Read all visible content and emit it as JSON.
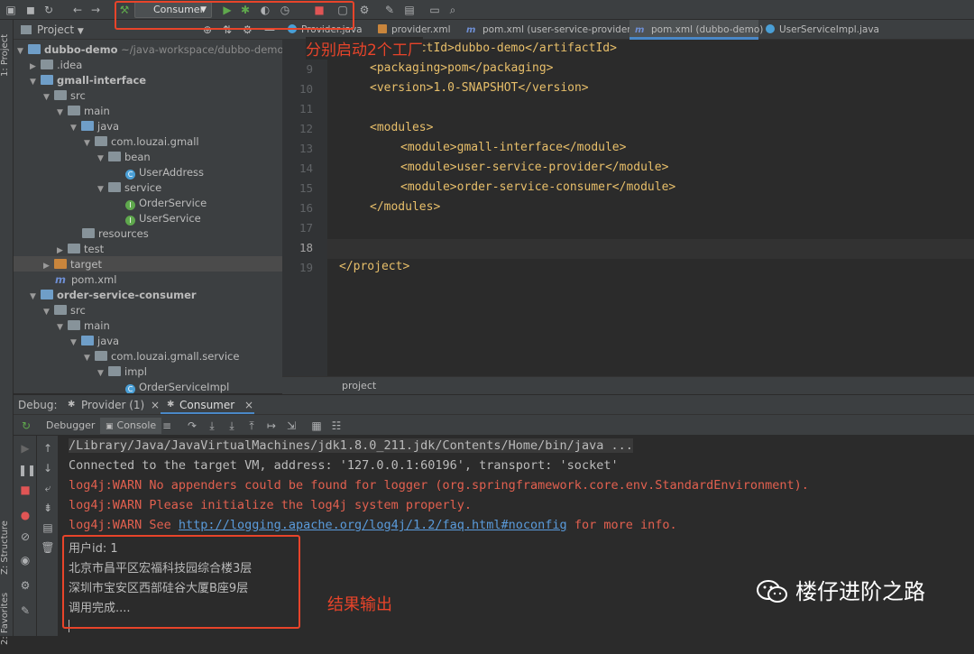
{
  "toolbar": {
    "run_config": "Consumer"
  },
  "annotations": {
    "toolbar_note": "分别启动2个工厂",
    "output_note": "结果输出"
  },
  "side_labels": {
    "project": "1: Project",
    "structure": "Z: Structure",
    "favorites": "2: Favorites"
  },
  "project_panel": {
    "title": "Project",
    "root_name": "dubbo-demo",
    "root_path": "~/java-workspace/dubbo-demo",
    "items": [
      {
        "label": "dubbo-demo",
        "extra": "~/java-workspace/dubbo-demo"
      },
      {
        "label": ".idea"
      },
      {
        "label": "gmall-interface"
      },
      {
        "label": "src"
      },
      {
        "label": "main"
      },
      {
        "label": "java"
      },
      {
        "label": "com.louzai.gmall"
      },
      {
        "label": "bean"
      },
      {
        "label": "UserAddress"
      },
      {
        "label": "service"
      },
      {
        "label": "OrderService"
      },
      {
        "label": "UserService"
      },
      {
        "label": "resources"
      },
      {
        "label": "test"
      },
      {
        "label": "target"
      },
      {
        "label": "pom.xml"
      },
      {
        "label": "order-service-consumer"
      },
      {
        "label": "src"
      },
      {
        "label": "main"
      },
      {
        "label": "java"
      },
      {
        "label": "com.louzai.gmall.service"
      },
      {
        "label": "impl"
      },
      {
        "label": "OrderServiceImpl"
      }
    ]
  },
  "editor_tabs": [
    {
      "label": "Provider.java"
    },
    {
      "label": "provider.xml"
    },
    {
      "label": "pom.xml (user-service-provider)"
    },
    {
      "label": "pom.xml (dubbo-demo)"
    },
    {
      "label": "UserServiceImpl.java"
    }
  ],
  "editor": {
    "lines": [
      {
        "n": "8",
        "text": "<artifactId>dubbo-demo</artifactId>"
      },
      {
        "n": "9",
        "text": "<packaging>pom</packaging>"
      },
      {
        "n": "10",
        "text": "<version>1.0-SNAPSHOT</version>"
      },
      {
        "n": "11",
        "text": ""
      },
      {
        "n": "12",
        "text": "<modules>"
      },
      {
        "n": "13",
        "text": "<module>gmall-interface</module>"
      },
      {
        "n": "14",
        "text": "<module>user-service-provider</module>"
      },
      {
        "n": "15",
        "text": "<module>order-service-consumer</module>"
      },
      {
        "n": "16",
        "text": "</modules>"
      },
      {
        "n": "17",
        "text": ""
      },
      {
        "n": "18",
        "text": ""
      },
      {
        "n": "19",
        "text": "</project>"
      }
    ],
    "breadcrumb": "project"
  },
  "debug": {
    "label": "Debug:",
    "tab1": "Provider (1)",
    "tab2": "Consumer",
    "sub_debugger": "Debugger",
    "sub_console": "Console"
  },
  "console": {
    "line1": "/Library/Java/JavaVirtualMachines/jdk1.8.0_211.jdk/Contents/Home/bin/java ...",
    "line2": "Connected to the target VM, address: '127.0.0.1:60196', transport: 'socket'",
    "line3": "log4j:WARN No appenders could be found for logger (org.springframework.core.env.StandardEnvironment).",
    "line4": "log4j:WARN Please initialize the log4j system properly.",
    "line5_pre": "log4j:WARN See ",
    "line5_link": "http://logging.apache.org/log4j/1.2/faq.html#noconfig",
    "line5_post": " for more info.",
    "line6": "用户id: 1",
    "line7": "北京市昌平区宏福科技园综合楼3层",
    "line8": "深圳市宝安区西部硅谷大厦B座9层",
    "line9": "调用完成...."
  },
  "watermark": "楼仔进阶之路"
}
